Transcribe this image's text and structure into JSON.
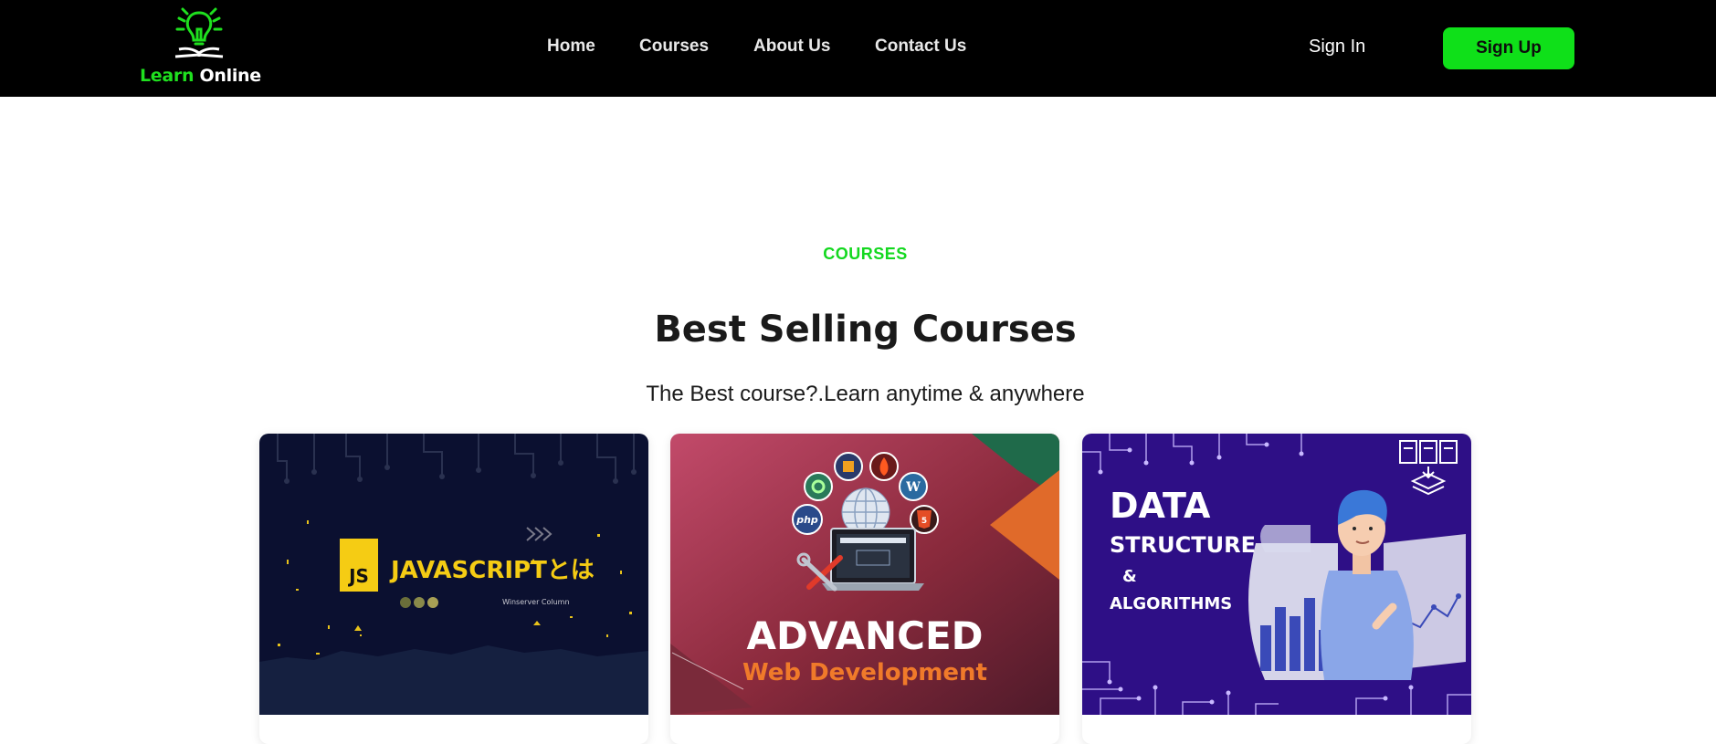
{
  "header": {
    "logo": {
      "word1": "Learn",
      "word2": "Online"
    },
    "nav": [
      {
        "label": "Home"
      },
      {
        "label": "Courses"
      },
      {
        "label": "About Us"
      },
      {
        "label": "Contact Us"
      }
    ],
    "signin_label": "Sign In",
    "signup_label": "Sign Up"
  },
  "section": {
    "eyebrow": "COURSES",
    "title": "Best Selling Courses",
    "subtitle": "The Best course?.Learn anytime & anywhere"
  },
  "courses": [
    {
      "thumb_title": "JAVASCRIPTとは",
      "badge": "JS",
      "caption": "Winserver Column"
    },
    {
      "line1": "ADVANCED",
      "line2": "Web Development",
      "icons": [
        "php",
        "5"
      ]
    },
    {
      "line1": "DATA",
      "line2": "STRUCTURE",
      "line3": "&",
      "line4": "ALGORITHMS"
    }
  ],
  "colors": {
    "header_bg": "#000000",
    "accent_green": "#0fe019",
    "title_text": "#1a1a1a"
  }
}
